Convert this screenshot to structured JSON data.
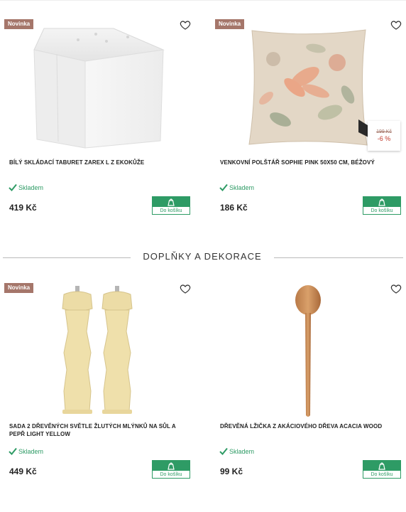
{
  "products_top": [
    {
      "badge": "Novinka",
      "title": "BÍLÝ SKLÁDACÍ TABURET ZAREX L Z EKOKŮŽE",
      "stock": "Skladem",
      "price": "419 Kč",
      "cart_label": "Do košíku",
      "image_icon": "ottoman-image"
    },
    {
      "badge": "Novinka",
      "title": "VENKOVNÍ POLŠTÁŘ SOPHIE PINK 50X50 CM, BÉŽOVÝ",
      "stock": "Skladem",
      "price": "186 Kč",
      "cart_label": "Do košíku",
      "old_price": "199 Kč",
      "discount": "-6 %",
      "image_icon": "pillow-image"
    }
  ],
  "section": {
    "title": "DOPLŇKY A DEKORACE"
  },
  "products_bottom": [
    {
      "badge": "Novinka",
      "title": "SADA 2 DŘEVĚNÝCH SVĚTLE ŽLUTÝCH MLÝNKŮ NA SŮL A PEPŘ LIGHT YELLOW",
      "stock": "Skladem",
      "price": "449 Kč",
      "cart_label": "Do košíku",
      "image_icon": "grinders-image"
    },
    {
      "title": "DŘEVĚNÁ LŽIČKA Z AKÁCIOVÉHO DŘEVA ACACIA WOOD",
      "stock": "Skladem",
      "price": "99 Kč",
      "cart_label": "Do košíku",
      "image_icon": "spoon-image"
    }
  ],
  "colors": {
    "badge": "#a5766a",
    "in_stock": "#2e9b65",
    "cart_button": "#2e9b65",
    "discount": "#c0392b"
  }
}
